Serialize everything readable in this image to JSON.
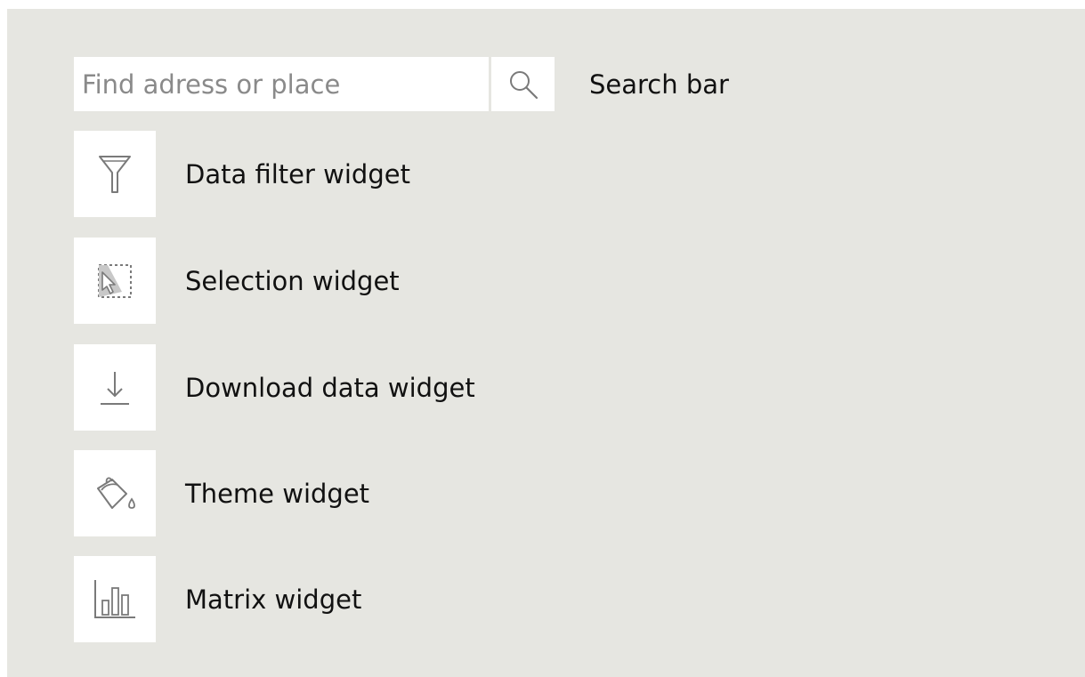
{
  "search": {
    "placeholder": "Find adress or place",
    "label": "Search bar",
    "icon": "search-icon"
  },
  "widgets": [
    {
      "icon": "filter-icon",
      "label": "Data filter widget"
    },
    {
      "icon": "selection-icon",
      "label": "Selection widget"
    },
    {
      "icon": "download-icon",
      "label": "Download data widget"
    },
    {
      "icon": "paint-bucket-icon",
      "label": "Theme widget"
    },
    {
      "icon": "bar-chart-icon",
      "label": "Matrix  widget"
    }
  ],
  "colors": {
    "panel_background": "#e6e6e1",
    "button_background": "#ffffff",
    "icon_stroke": "#7a7a7a",
    "text": "#111111"
  }
}
